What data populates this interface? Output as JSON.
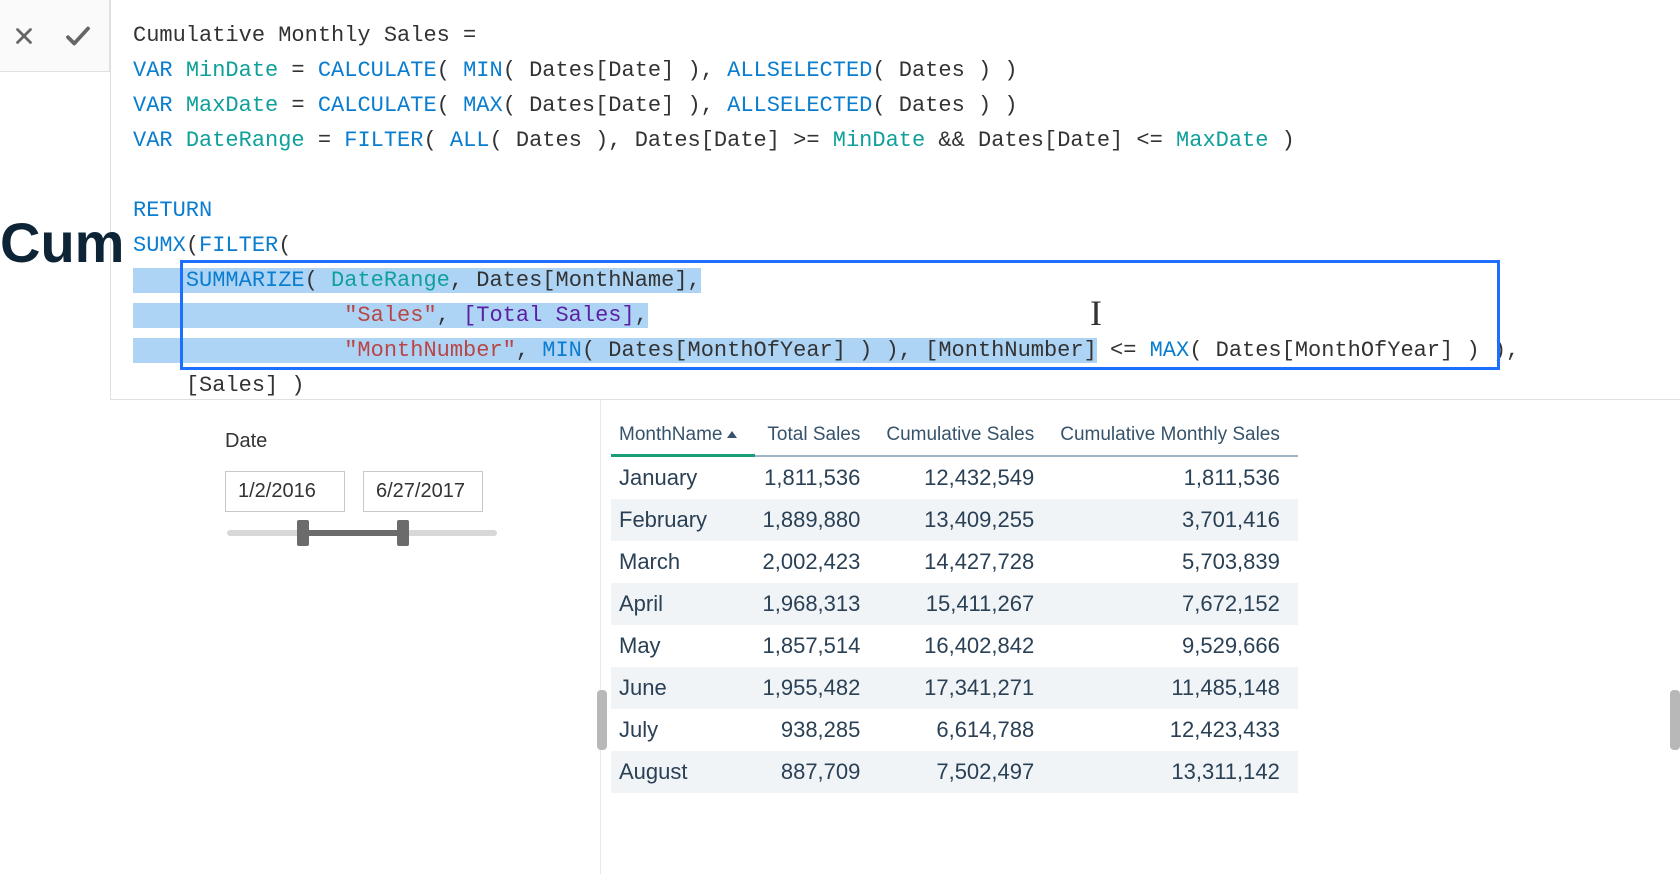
{
  "heading_fragment": "Cum",
  "formula": {
    "measure_name": "Cumulative Monthly Sales",
    "var1_name": "MinDate",
    "var1_fn1": "CALCULATE",
    "var1_fn2": "MIN",
    "var1_col": "Dates[Date]",
    "var1_fn3": "ALLSELECTED",
    "var1_arg": "Dates",
    "var2_name": "MaxDate",
    "var2_fn1": "CALCULATE",
    "var2_fn2": "MAX",
    "var2_col": "Dates[Date]",
    "var2_fn3": "ALLSELECTED",
    "var2_arg": "Dates",
    "var3_name": "DateRange",
    "var3_fn1": "FILTER",
    "var3_fn2": "ALL",
    "var3_arg": "Dates",
    "var3_col": "Dates[Date]",
    "return": "RETURN",
    "sumx": "SUMX",
    "filter": "FILTER",
    "summarize": "SUMMARIZE",
    "summarize_arg1": "DateRange",
    "summarize_col": "Dates[MonthName]",
    "str_sales": "\"Sales\"",
    "meas_total": "[Total Sales]",
    "str_mn": "\"MonthNumber\"",
    "min_fn": "MIN",
    "min_col": "Dates[MonthOfYear]",
    "mn_ref": "[MonthNumber]",
    "max_fn": "MAX",
    "max_col": "Dates[MonthOfYear]",
    "last": "[Sales]"
  },
  "slicer": {
    "title": "Date",
    "from": "1/2/2016",
    "to": "6/27/2017"
  },
  "table": {
    "headers": [
      "MonthName",
      "Total Sales",
      "Cumulative Sales",
      "Cumulative Monthly Sales"
    ],
    "rows": [
      {
        "m": "January",
        "t": "1,811,536",
        "c": "12,432,549",
        "cm": "1,811,536"
      },
      {
        "m": "February",
        "t": "1,889,880",
        "c": "13,409,255",
        "cm": "3,701,416"
      },
      {
        "m": "March",
        "t": "2,002,423",
        "c": "14,427,728",
        "cm": "5,703,839"
      },
      {
        "m": "April",
        "t": "1,968,313",
        "c": "15,411,267",
        "cm": "7,672,152"
      },
      {
        "m": "May",
        "t": "1,857,514",
        "c": "16,402,842",
        "cm": "9,529,666"
      },
      {
        "m": "June",
        "t": "1,955,482",
        "c": "17,341,271",
        "cm": "11,485,148"
      },
      {
        "m": "July",
        "t": "938,285",
        "c": "6,614,788",
        "cm": "12,423,433"
      },
      {
        "m": "August",
        "t": "887,709",
        "c": "7,502,497",
        "cm": "13,311,142"
      }
    ]
  },
  "chart_data": {
    "type": "table",
    "title": "Cumulative Monthly Sales",
    "categories": [
      "January",
      "February",
      "March",
      "April",
      "May",
      "June",
      "July",
      "August"
    ],
    "series": [
      {
        "name": "Total Sales",
        "values": [
          1811536,
          1889880,
          2002423,
          1968313,
          1857514,
          1955482,
          938285,
          887709
        ]
      },
      {
        "name": "Cumulative Sales",
        "values": [
          12432549,
          13409255,
          14427728,
          15411267,
          16402842,
          17341271,
          6614788,
          7502497
        ]
      },
      {
        "name": "Cumulative Monthly Sales",
        "values": [
          1811536,
          3701416,
          5703839,
          7672152,
          9529666,
          11485148,
          12423433,
          13311142
        ]
      }
    ]
  }
}
